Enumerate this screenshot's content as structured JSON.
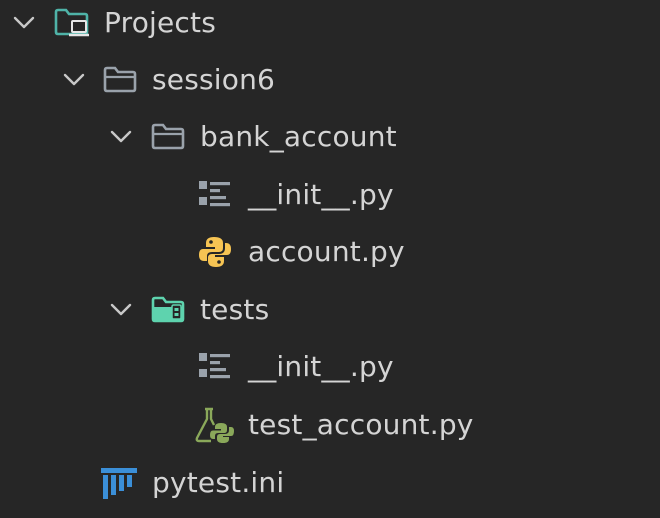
{
  "tree": {
    "root": {
      "label": "Projects",
      "icon": "project-folder-icon",
      "expanded": true
    },
    "session": {
      "label": "session6",
      "icon": "folder-icon",
      "expanded": true
    },
    "bank_account": {
      "label": "bank_account",
      "icon": "folder-icon",
      "expanded": true
    },
    "bank_init": {
      "label": "__init__.py",
      "icon": "init-file-icon"
    },
    "account": {
      "label": "account.py",
      "icon": "python-icon"
    },
    "tests": {
      "label": "tests",
      "icon": "test-folder-icon",
      "expanded": true
    },
    "tests_init": {
      "label": "__init__.py",
      "icon": "init-file-icon"
    },
    "test_account": {
      "label": "test_account.py",
      "icon": "python-test-icon"
    },
    "pytest_ini": {
      "label": "pytest.ini",
      "icon": "pytest-icon"
    }
  },
  "colors": {
    "background": "#262626",
    "text": "#d4d4d4",
    "chevron": "#c8c8c8",
    "folder": "#9aa2ab",
    "project_folder": "#4fb3a8",
    "test_folder": "#5ed3ae",
    "python_yellow": "#f6c453",
    "python_green": "#8aa85a",
    "pytest_blue": "#3b8fd8"
  }
}
